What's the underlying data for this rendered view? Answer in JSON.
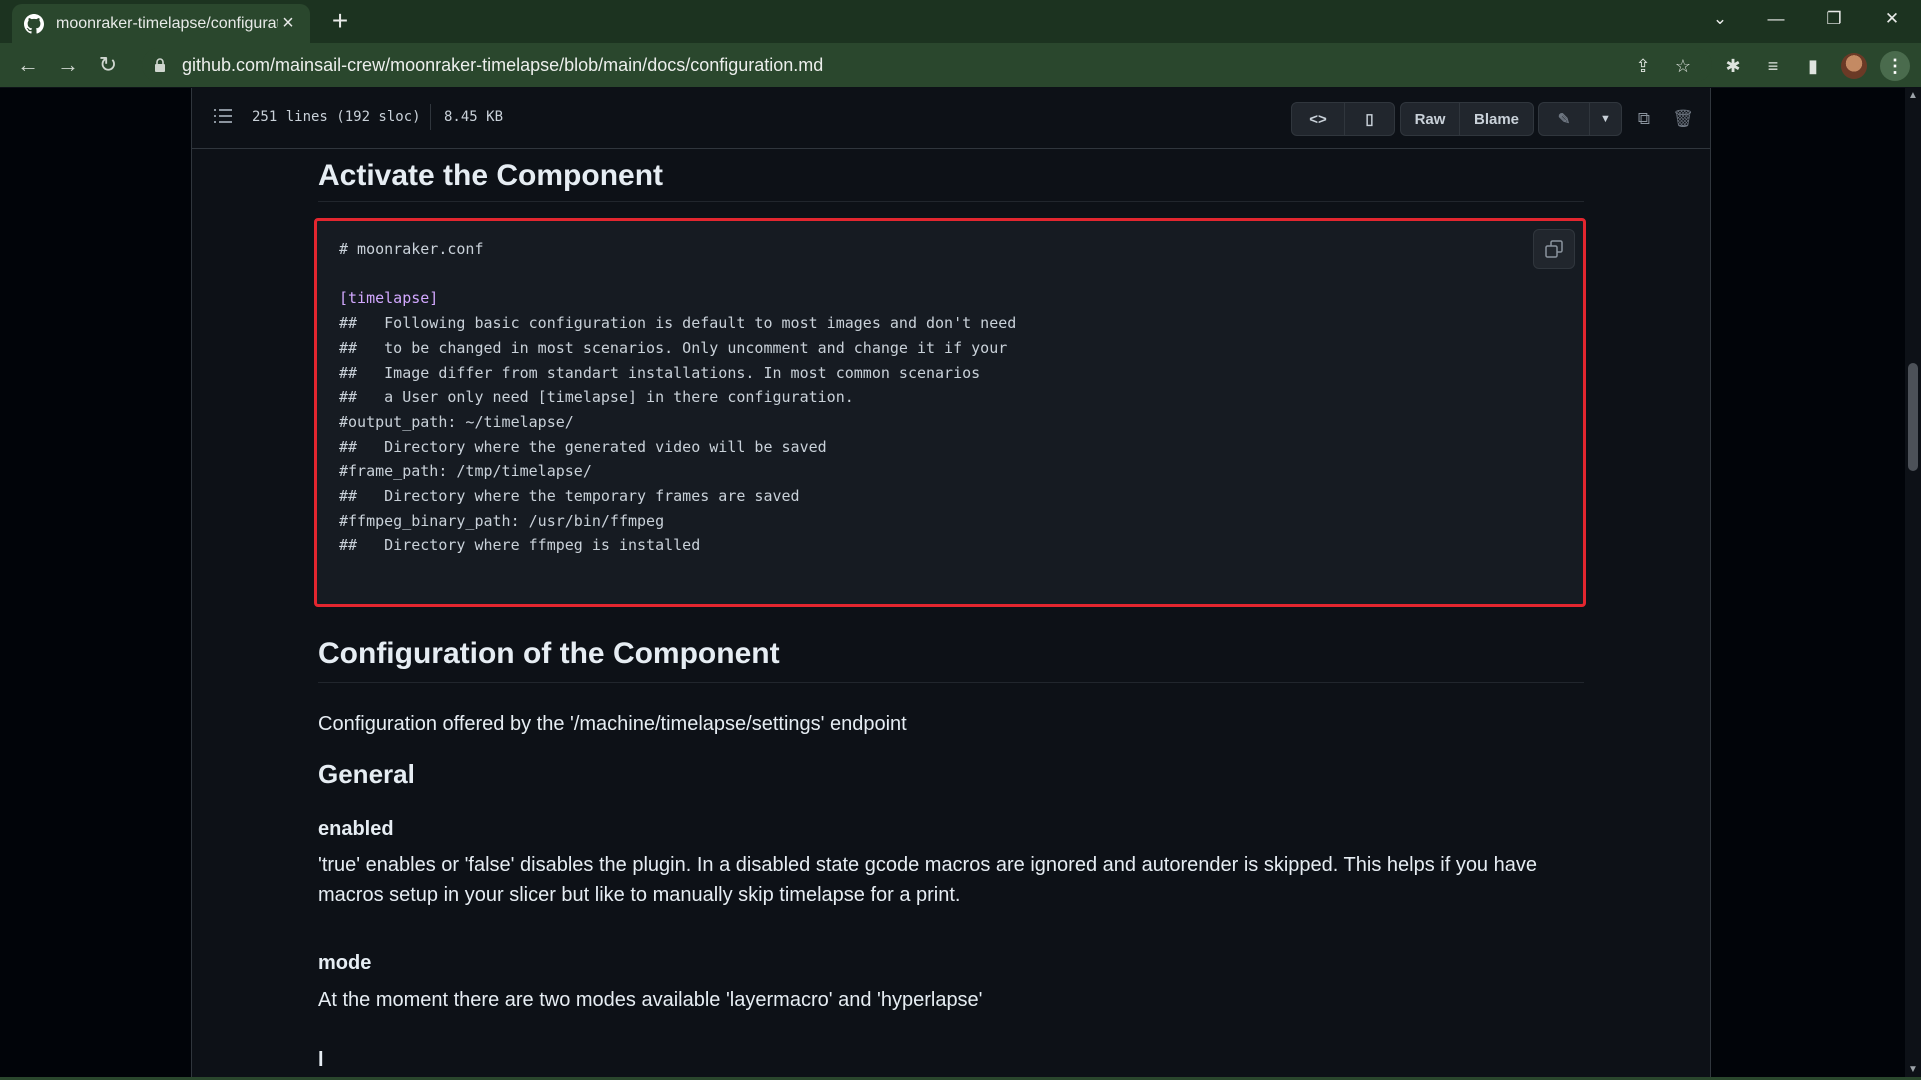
{
  "browser": {
    "tab_title": "moonraker-timelapse/configurat",
    "url": "github.com/mainsail-crew/moonraker-timelapse/blob/main/docs/configuration.md",
    "new_tab": "+",
    "close_tab": "×"
  },
  "file_header": {
    "lines": "251 lines (192 sloc)",
    "size": "8.45 KB",
    "raw_label": "Raw",
    "blame_label": "Blame"
  },
  "content": {
    "h_activate": "Activate the Component",
    "code_lines": [
      "# moonraker.conf",
      "",
      "[timelapse]",
      "##   Following basic configuration is default to most images and don't need",
      "##   to be changed in most scenarios. Only uncomment and change it if your",
      "##   Image differ from standart installations. In most common scenarios",
      "##   a User only need [timelapse] in there configuration.",
      "#output_path: ~/timelapse/",
      "##   Directory where the generated video will be saved",
      "#frame_path: /tmp/timelapse/",
      "##   Directory where the temporary frames are saved",
      "#ffmpeg_binary_path: /usr/bin/ffmpeg",
      "##   Directory where ffmpeg is installed"
    ],
    "h_config": "Configuration of the Component",
    "p_config": "Configuration offered by the '/machine/timelapse/settings' endpoint",
    "h_general": "General",
    "h_enabled": "enabled",
    "p_enabled": "'true' enables or 'false' disables the plugin. In a disabled state gcode macros are ignored and autorender is skipped. This helps if you have macros setup in your slicer but like to manually skip timelapse for a print.",
    "h_mode": "mode",
    "p_mode": "At the moment there are two modes available 'layermacro' and 'hyperlapse'",
    "h_cut": "l"
  },
  "colors": {
    "highlight_border": "#e3262f",
    "section_name": "#d2a8ff",
    "chrome": "#2a472d"
  }
}
